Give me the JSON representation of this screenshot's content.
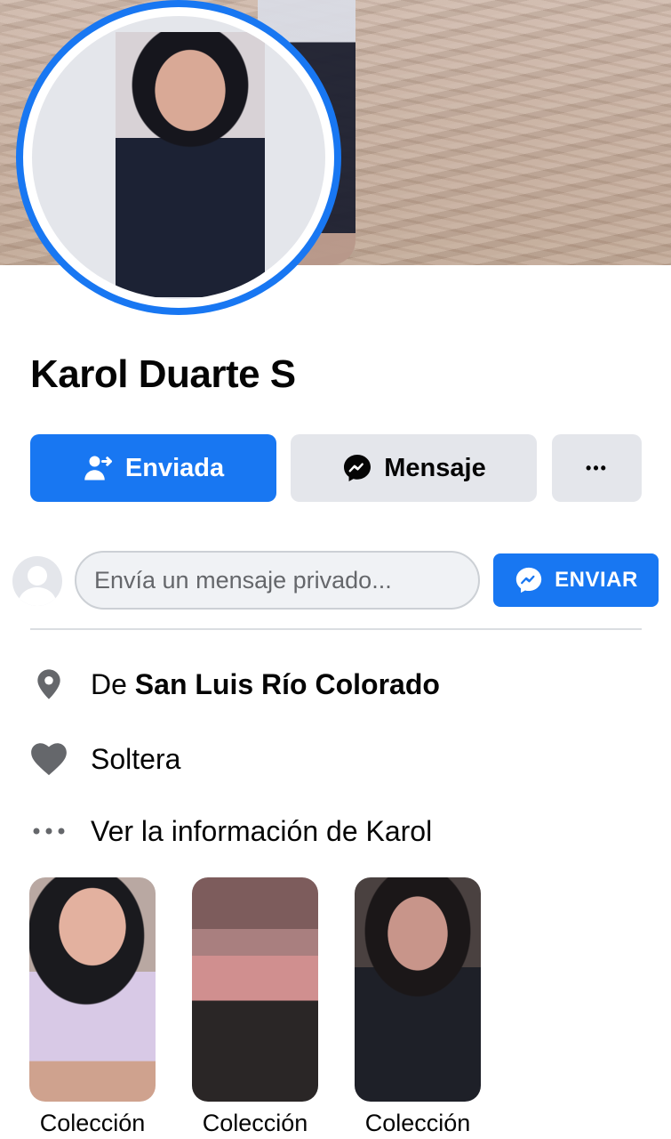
{
  "profile": {
    "name": "Karol Duarte S"
  },
  "actions": {
    "sent_label": "Enviada",
    "message_label": "Mensaje",
    "more_label": "•••"
  },
  "composer": {
    "placeholder": "Envía un mensaje privado...",
    "send_label": "ENVIAR"
  },
  "intro": {
    "from_prefix": "De",
    "from_place": "San Luis Río Colorado",
    "relationship": "Soltera",
    "see_info": "Ver la información de Karol"
  },
  "highlights": [
    {
      "label": "Colección"
    },
    {
      "label": "Colección"
    },
    {
      "label": "Colección"
    }
  ],
  "colors": {
    "accent": "#1877f2",
    "button_gray": "#e4e6eb",
    "icon_gray": "#65676b"
  },
  "icons": {
    "sent": "person-check-icon",
    "messenger": "messenger-icon",
    "location": "map-pin-icon",
    "relationship": "heart-icon",
    "more": "more-dots-icon"
  }
}
